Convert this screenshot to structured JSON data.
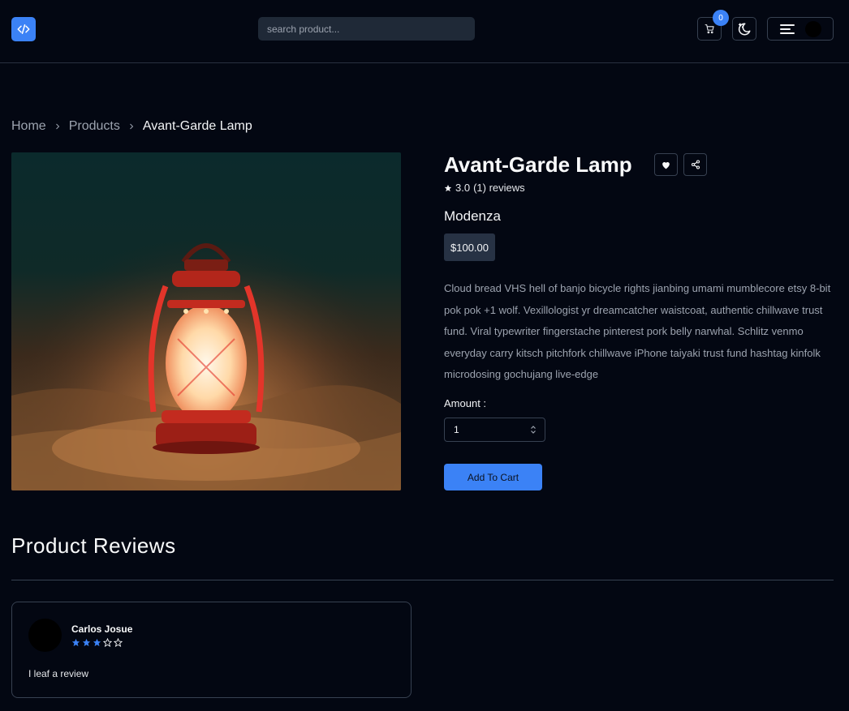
{
  "header": {
    "logo_icon": "code-icon",
    "search_placeholder": "search product...",
    "cart_count": "0",
    "cart_icon": "cart-icon",
    "theme_icon": "moon-icon",
    "menu_icon": "hamburger-icon",
    "accent": "#3b82f6"
  },
  "breadcrumb": {
    "items": [
      "Home",
      "Products"
    ],
    "current": "Avant-Garde Lamp"
  },
  "product": {
    "title": "Avant-Garde Lamp",
    "rating": "3.0",
    "reviews_text": "(1) reviews",
    "brand": "Modenza",
    "price": "$100.00",
    "description": "Cloud bread VHS hell of banjo bicycle rights jianbing umami mumblecore etsy 8-bit pok pok +1 wolf. Vexillologist yr dreamcatcher waistcoat, authentic chillwave trust fund. Viral typewriter fingerstache pinterest pork belly narwhal. Schlitz venmo everyday carry kitsch pitchfork chillwave iPhone taiyaki trust fund hashtag kinfolk microdosing gochujang live-edge",
    "amount_label": "Amount :",
    "amount_value": "1",
    "add_to_cart_label": "Add To Cart",
    "image_subject": "red lantern on sand"
  },
  "reviews": {
    "title": "Product Reviews",
    "items": [
      {
        "name": "Carlos Josue",
        "stars": 3,
        "max_stars": 5,
        "text": "I leaf a review"
      }
    ]
  }
}
